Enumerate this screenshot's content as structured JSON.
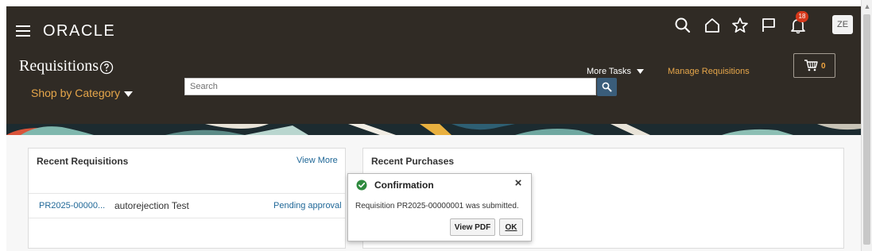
{
  "header": {
    "brand": "ORACLE",
    "notification_count": "18",
    "avatar_initials": "ZE",
    "page_title": "Requisitions",
    "more_tasks_label": "More Tasks",
    "manage_requisitions_label": "Manage Requisitions",
    "cart_count": "0",
    "shop_by_category_label": "Shop by Category",
    "search": {
      "placeholder": "Search",
      "value": ""
    }
  },
  "recent_requisitions": {
    "title": "Recent Requisitions",
    "view_more_label": "View More",
    "rows": [
      {
        "number": "PR2025-00000...",
        "description": "autorejection Test",
        "status": "Pending approval"
      }
    ]
  },
  "recent_purchases": {
    "title": "Recent Purchases"
  },
  "confirmation": {
    "title": "Confirmation",
    "message": "Requisition PR2025-00000001 was submitted.",
    "view_pdf_label": "View PDF",
    "ok_label": "OK"
  },
  "colors": {
    "header_bg": "#302b25",
    "accent_gold": "#e6a64a",
    "link_blue": "#1f6797",
    "badge_red": "#d6381b",
    "success_green": "#2e8a3e"
  }
}
